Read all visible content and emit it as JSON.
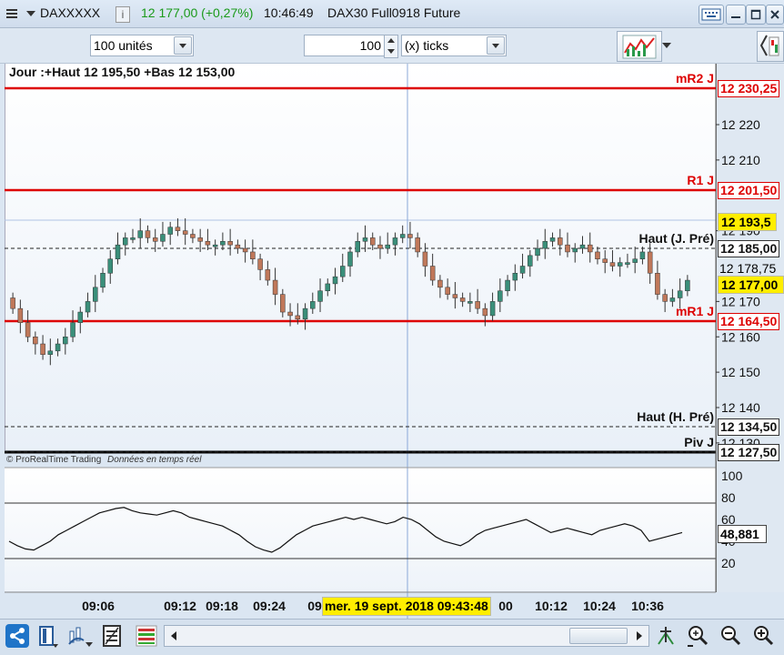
{
  "titlebar": {
    "instrument": "DAXXXXX",
    "info_icon": "i",
    "price_change": "12 177,00 (+0,27%)",
    "time": "10:46:49",
    "description": "DAX30 Full0918 Future",
    "change_color": "#1a9a1a"
  },
  "toolbar": {
    "units_value": "100 unités",
    "ticks_number": "100",
    "ticks_unit": "(x) ticks"
  },
  "chart": {
    "header": "Jour :+Haut 12 195,50 +Bas 12 153,00",
    "watermark_brand": "© ProRealTime Trading",
    "watermark_status": "Données en temps réel",
    "y_ticks": [
      "12 220",
      "12 210",
      "12 190",
      "12 170",
      "12 160",
      "12 150",
      "12 140",
      "12 130"
    ],
    "levels": [
      {
        "name": "mR2 J",
        "value": "12 230,25",
        "color": "#dd0000"
      },
      {
        "name": "R1 J",
        "value": "12 201,50",
        "color": "#dd0000"
      },
      {
        "name": "Haut (J. Pré)",
        "value": "12 185,00",
        "color": "#111111"
      },
      {
        "name": "mR1 J",
        "value": "12 164,50",
        "color": "#dd0000"
      },
      {
        "name": "Haut (H. Pré)",
        "value": "12 134,50",
        "color": "#111111"
      },
      {
        "name": "Piv J",
        "value": "12 127,50",
        "color": "#111111"
      }
    ],
    "price_labels": {
      "crosshair": "12 193,5",
      "ref": "12 178,75",
      "last": "12 177,00"
    },
    "x_ticks": [
      "09:06",
      "09:12",
      "09:18",
      "09:24",
      "09",
      "00",
      "10:12",
      "10:24",
      "10:36"
    ],
    "crosshair_date": "mer. 19 sept. 2018 09:43:48",
    "up_color": "#3a8f7a",
    "down_color": "#c0785a"
  },
  "indicator": {
    "y_ticks": [
      "100",
      "80",
      "60",
      "40",
      "20"
    ],
    "current_value": "48,881"
  },
  "bottom_icons": [
    "share-icon",
    "layout-icon",
    "indicators-icon",
    "list-icon",
    "trades-icon",
    "zoom-fit-icon",
    "zoom-out-icon",
    "zoom-in-icon"
  ]
}
